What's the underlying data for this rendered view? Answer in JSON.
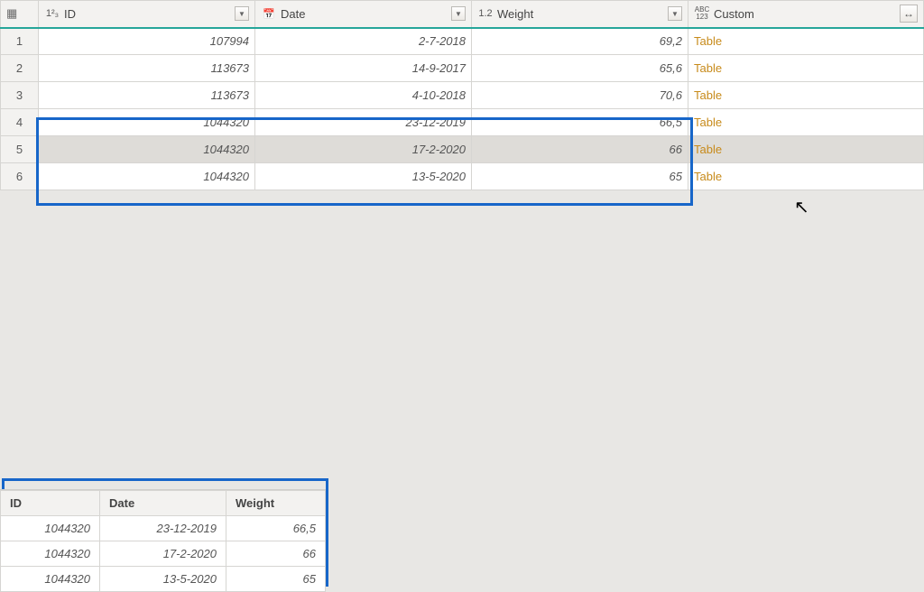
{
  "columns": {
    "id_type": "1²₃",
    "id_label": "ID",
    "date_label": "Date",
    "weight_type": "1.2",
    "weight_label": "Weight",
    "custom_type_top": "ABC",
    "custom_type_bottom": "123",
    "custom_label": "Custom"
  },
  "rows": [
    {
      "n": "1",
      "id": "107994",
      "date": "2-7-2018",
      "weight": "69,2",
      "custom": "Table"
    },
    {
      "n": "2",
      "id": "113673",
      "date": "14-9-2017",
      "weight": "65,6",
      "custom": "Table"
    },
    {
      "n": "3",
      "id": "113673",
      "date": "4-10-2018",
      "weight": "70,6",
      "custom": "Table"
    },
    {
      "n": "4",
      "id": "1044320",
      "date": "23-12-2019",
      "weight": "66,5",
      "custom": "Table"
    },
    {
      "n": "5",
      "id": "1044320",
      "date": "17-2-2020",
      "weight": "66",
      "custom": "Table"
    },
    {
      "n": "6",
      "id": "1044320",
      "date": "13-5-2020",
      "weight": "65",
      "custom": "Table"
    }
  ],
  "selected_row_index": 4,
  "detail": {
    "headers": {
      "id": "ID",
      "date": "Date",
      "weight": "Weight"
    },
    "rows": [
      {
        "id": "1044320",
        "date": "23-12-2019",
        "weight": "66,5"
      },
      {
        "id": "1044320",
        "date": "17-2-2020",
        "weight": "66"
      },
      {
        "id": "1044320",
        "date": "13-5-2020",
        "weight": "65"
      }
    ]
  },
  "glyphs": {
    "filter_down": "▼",
    "expand": "↔",
    "table_corner": "▦"
  }
}
